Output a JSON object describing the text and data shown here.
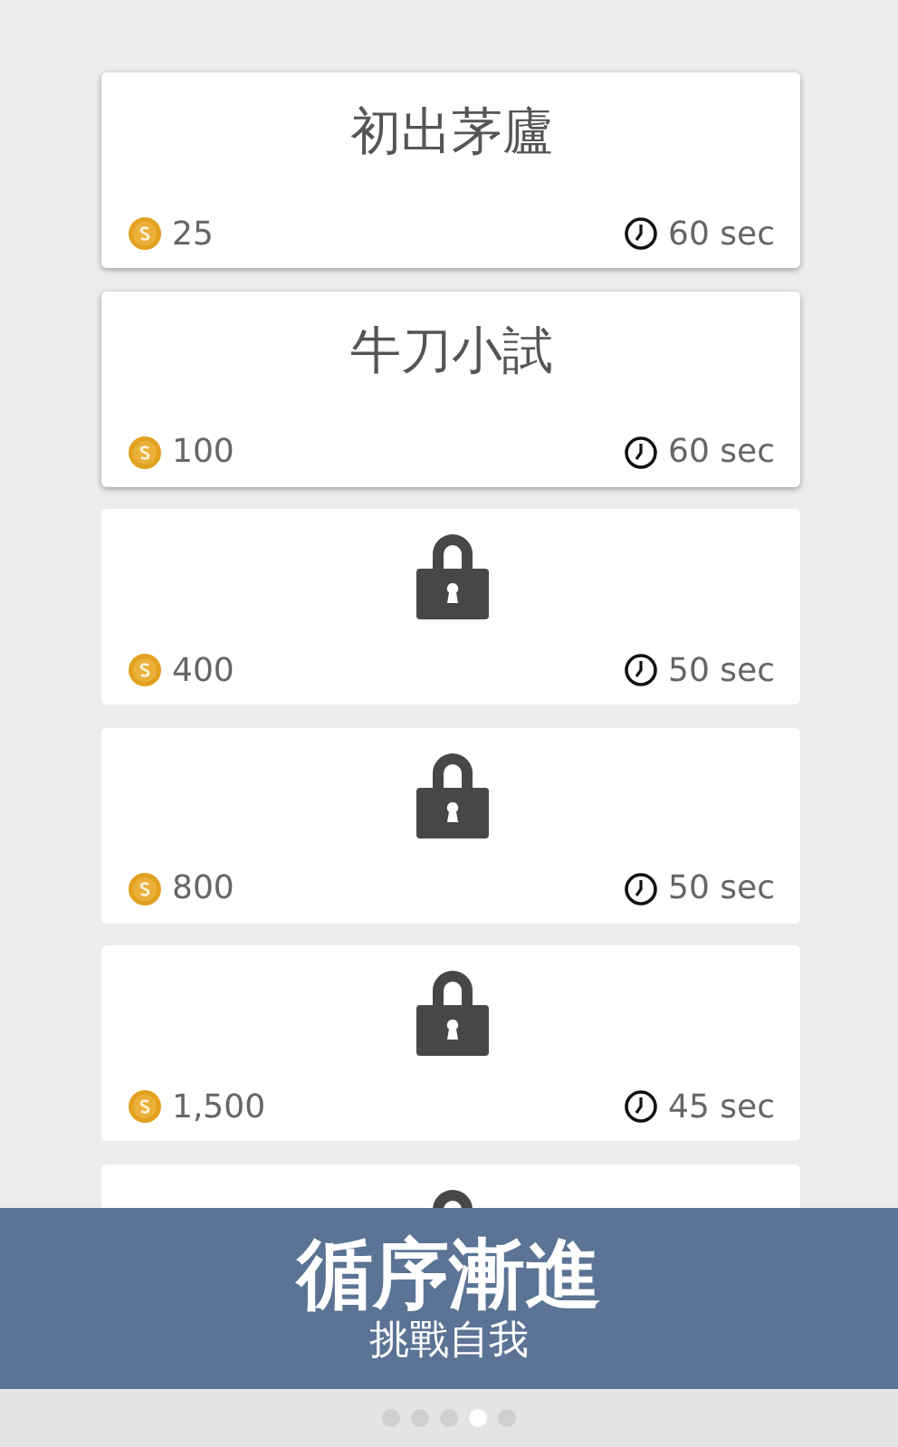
{
  "levels": [
    {
      "locked": false,
      "title": "初出茅廬",
      "coins": "25",
      "time": "60 sec"
    },
    {
      "locked": false,
      "title": "牛刀小試",
      "coins": "100",
      "time": "60 sec"
    },
    {
      "locked": true,
      "coins": "400",
      "time": "50 sec"
    },
    {
      "locked": true,
      "coins": "800",
      "time": "50 sec"
    },
    {
      "locked": true,
      "coins": "1,500",
      "time": "45 sec"
    },
    {
      "locked": true
    }
  ],
  "banner": {
    "title": "循序漸進",
    "subtitle": "挑戰自我"
  },
  "pager": [
    {
      "selected": false
    },
    {
      "selected": false
    },
    {
      "selected": false
    },
    {
      "selected": true
    },
    {
      "selected": false
    }
  ]
}
